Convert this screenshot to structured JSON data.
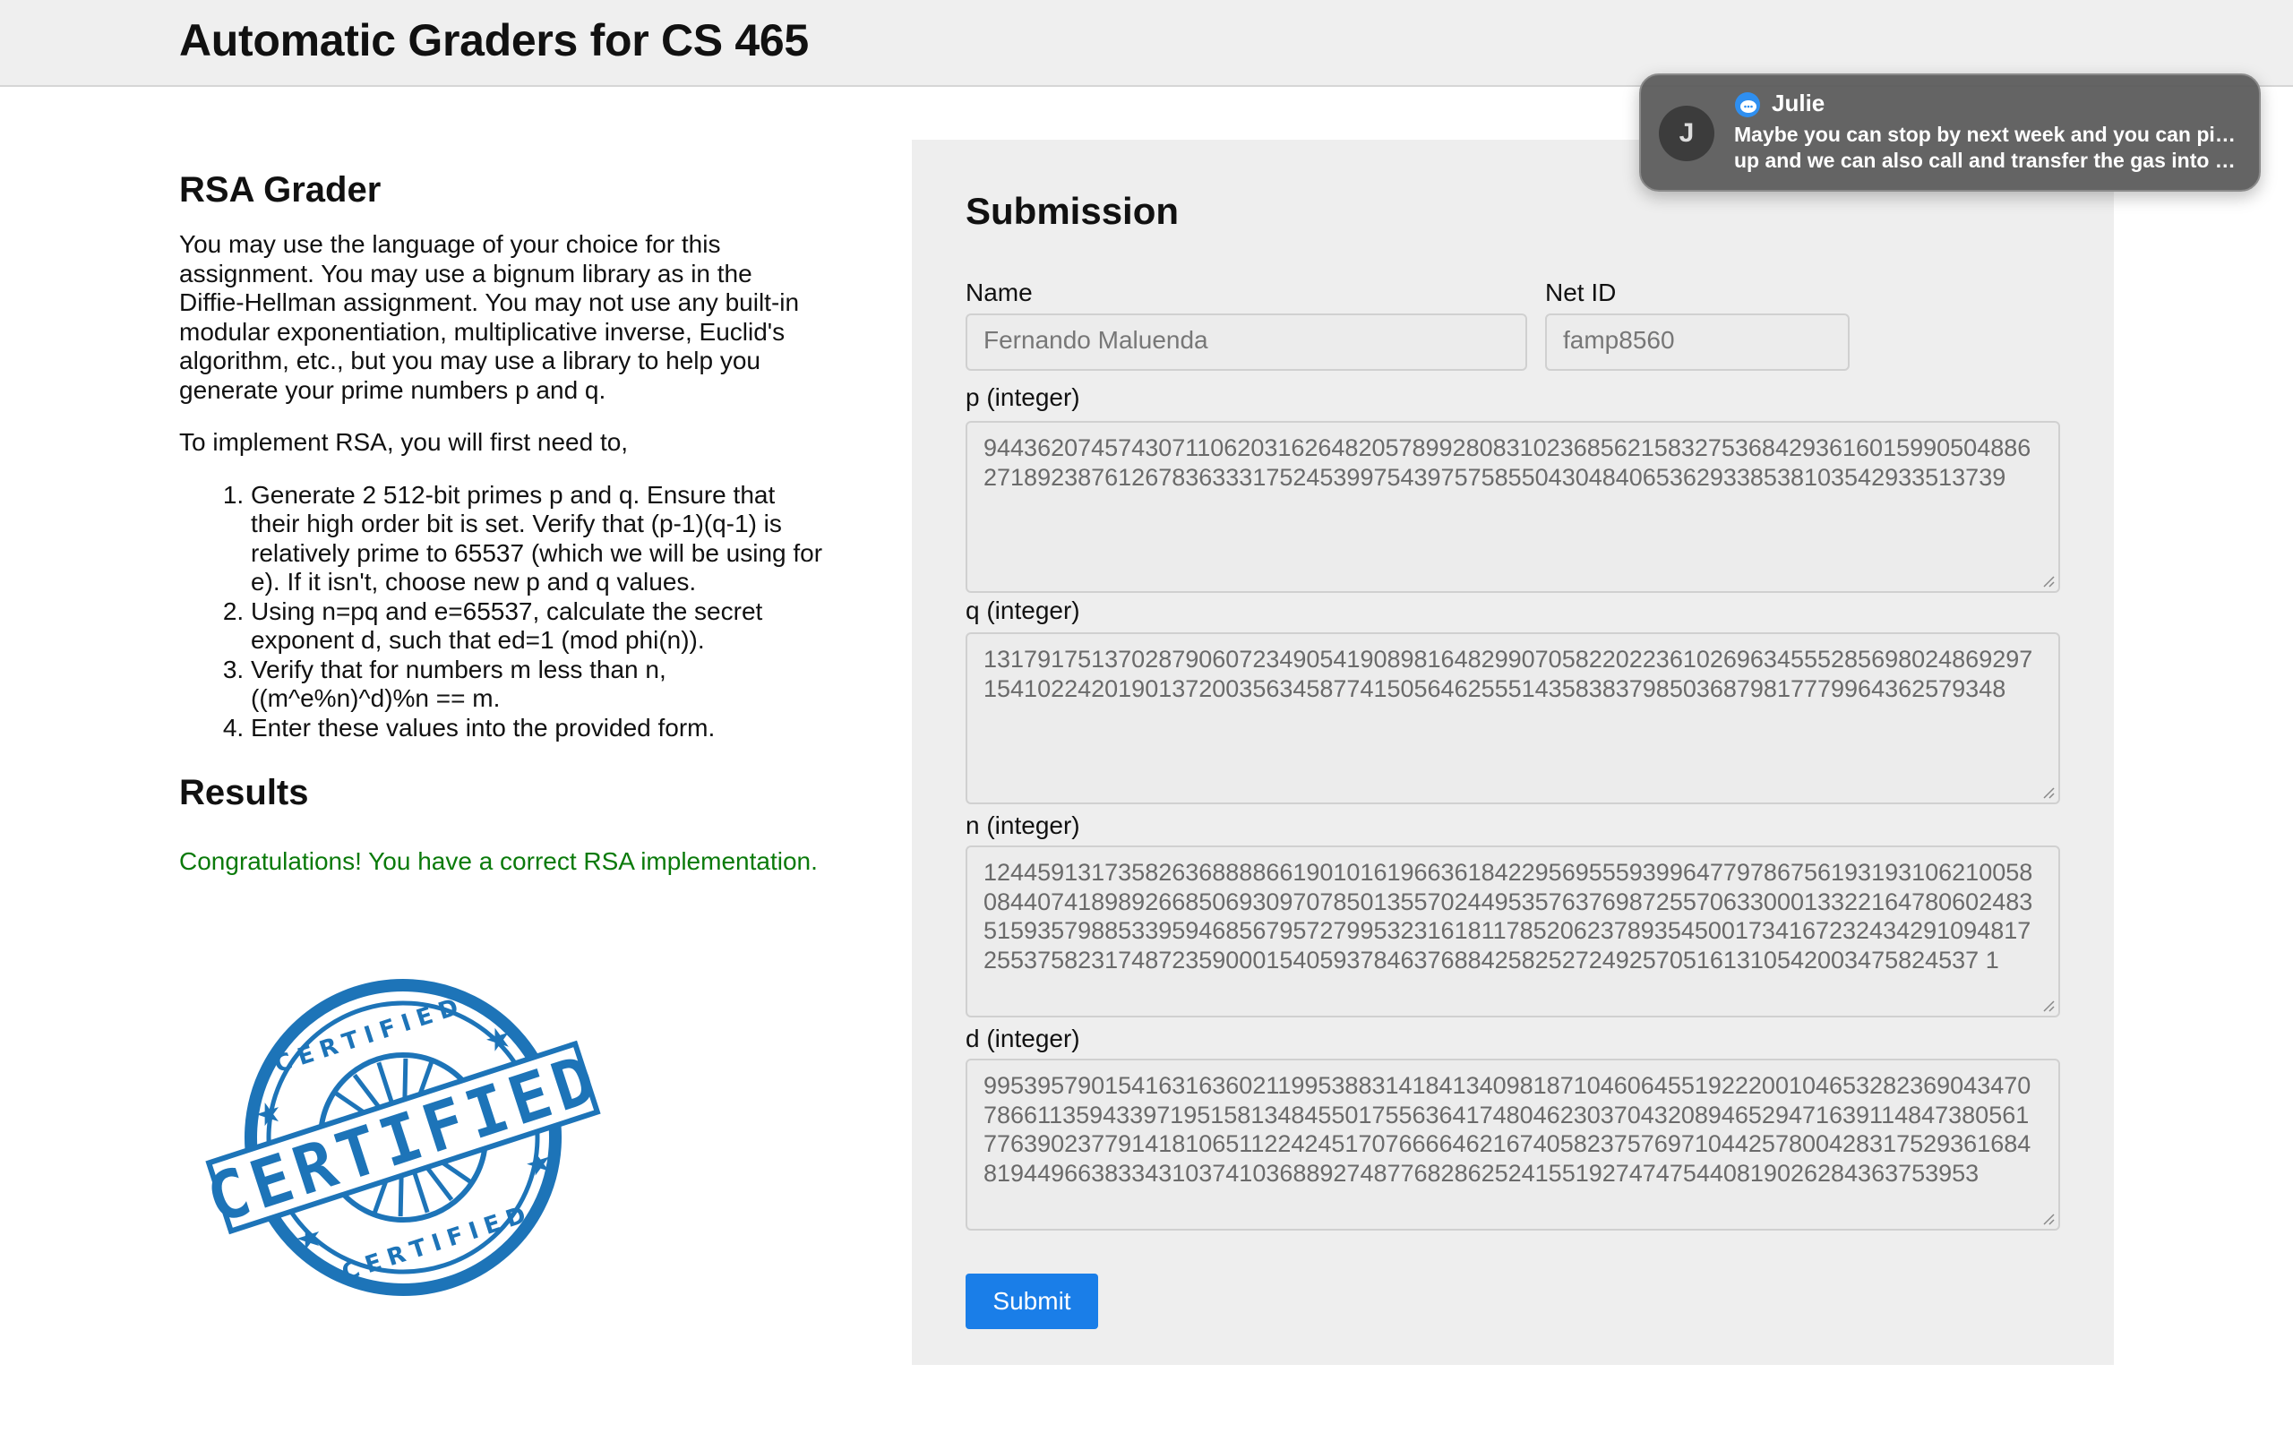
{
  "header": {
    "title": "Automatic Graders for CS 465"
  },
  "grader": {
    "title": "RSA Grader",
    "intro": "You may use the language of your choice for this assignment. You may use a bignum library as in the Diffie-Hellman assignment. You may not use any built-in modular exponentiation, multiplicative inverse, Euclid's algorithm, etc., but you may use a library to help you generate your prime numbers p and q.",
    "lead": "To implement RSA, you will first need to,",
    "steps": [
      "Generate 2 512-bit primes p and q. Ensure that their high order bit is set. Verify that (p-1)(q-1) is relatively prime to 65537 (which we will be using for e). If it isn't, choose new p and q values.",
      "Using n=pq and e=65537, calculate the secret exponent d, such that ed=1 (mod phi(n)).",
      "Verify that for numbers m less than n, ((m^e%n)^d)%n == m.",
      "Enter these values into the provided form."
    ]
  },
  "results": {
    "title": "Results",
    "message": "Congratulations! You have a correct RSA implementation.",
    "stamp_text_main": "CERTIFIED",
    "stamp_text_top": "CERTIFIED",
    "stamp_text_bottom": "CERTIFIED"
  },
  "submission": {
    "title": "Submission",
    "name_label": "Name",
    "name_value": "Fernando Maluenda",
    "netid_label": "Net ID",
    "netid_value": "famp8560",
    "p_label": "p (integer)",
    "p_value": "9443620745743071106203162648205789928083102368562158327536842936160159905048862718923876126783633317524539975439757585504304840653629338538103542933513739",
    "q_label": "q (integer)",
    "q_value": "1317917513702879060723490541908981648299070582202236102696345552856980248692971541022420190137200356345877415056462555143583837985036879817779964362579348",
    "n_label": "n (integer)",
    "n_value": "12445913173582636888866190101619663618422956955593996477978675619319310621005808440741898926685069309707850135570244953576376987255706330001332216478060248351593579885339594685679572799532316181178520623789354500173416723243429109481725537582317487235900015405937846376884258252724925705161310542003475824537 1",
    "d_value": "99539579015416316360211995388314184134098187104606455192220010465328236904347078661135943397195158134845501755636417480462303704320894652947163911484738056177639023779141810651122424517076666462167405823757697104425780042831752936168481944966383343103741036889274877682862524155192747475440819026284363753953",
    "d_label": "d (integer)",
    "submit_label": "Submit"
  },
  "notification": {
    "avatar_initial": "J",
    "sender": "Julie",
    "line1": "Maybe you can stop by next week and you can pick it",
    "line2": "up and we can also call and transfer the gas into my…",
    "app_icon": "messages-icon"
  },
  "colors": {
    "success": "#0a7a0a",
    "accent": "#1a7ee8",
    "stamp": "#1d74b8"
  }
}
